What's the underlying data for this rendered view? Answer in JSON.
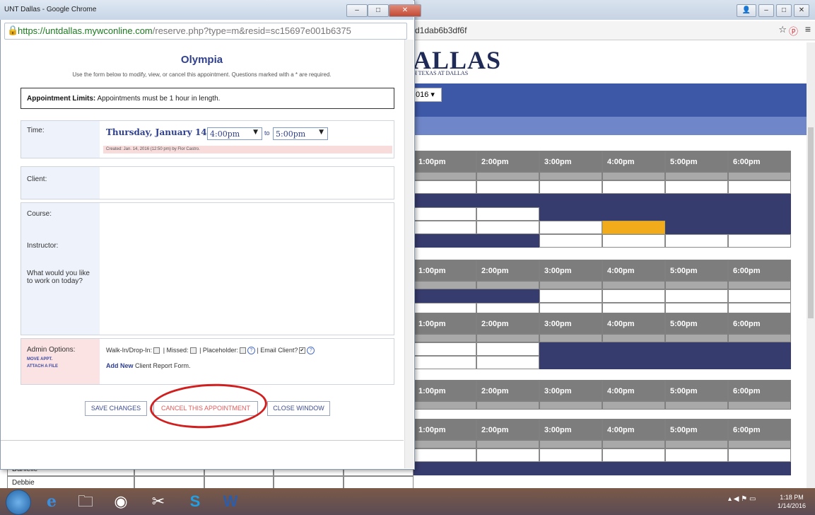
{
  "background": {
    "url_fragment": "d1dab6b3df6f",
    "logo_text": "ALLAS",
    "logo_sub": "H TEXAS AT DALLAS",
    "date_select": "016",
    "header_times": [
      "1:00pm",
      "2:00pm",
      "3:00pm",
      "4:00pm",
      "5:00pm",
      "6:00pm"
    ],
    "left_rows": [
      "Danielle",
      "Debbie"
    ]
  },
  "popup": {
    "window_title": "UNT Dallas - Google Chrome",
    "url_host": "https://untdallas.mywconline.com",
    "url_path": "/reserve.php?type=m&resid=sc15697e001b6375",
    "heading": "Olympia",
    "intro": "Use the form below to modify, view, or cancel this appointment. Questions marked with a * are required.",
    "limits_label": "Appointment Limits:",
    "limits_text": "Appointments must be 1 hour in length.",
    "time_label": "Time:",
    "date_text": "Thursday, January 14:",
    "start_time": "4:00pm",
    "to_text": "to",
    "end_time": "5:00pm",
    "created_text": "Created: Jan. 14, 2016 (12:50 pm) by Flor Castro.",
    "client_label": "Client:",
    "course_label": "Course:",
    "instructor_label": "Instructor:",
    "work_label": "What would you like to work on today?",
    "admin_label": "Admin Options:",
    "move_appt": "MOVE APPT.",
    "attach_file": "ATTACH A FILE",
    "walkin_label": "Walk-In/Drop-In:",
    "missed_label": "| Missed:",
    "placeholder_label": "| Placeholder:",
    "email_label": "| Email Client?",
    "add_new": "Add New",
    "client_report": "Client Report Form.",
    "save_button": "SAVE CHANGES",
    "cancel_button": "CANCEL THIS APPOINTMENT",
    "close_button": "CLOSE WINDOW"
  },
  "taskbar": {
    "time": "1:18 PM",
    "date": "1/14/2016"
  },
  "colors": {
    "booked": "#373c6e",
    "highlight": "#f2ab1a",
    "header_blue": "#3e58a8",
    "annotation_red": "#d11f1f"
  }
}
